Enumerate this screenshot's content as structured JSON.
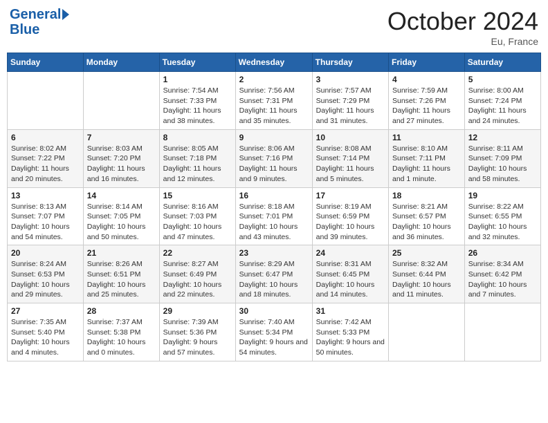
{
  "header": {
    "logo_line1": "General",
    "logo_line2": "Blue",
    "month": "October 2024",
    "location": "Eu, France"
  },
  "weekdays": [
    "Sunday",
    "Monday",
    "Tuesday",
    "Wednesday",
    "Thursday",
    "Friday",
    "Saturday"
  ],
  "weeks": [
    [
      {
        "day": "",
        "info": ""
      },
      {
        "day": "",
        "info": ""
      },
      {
        "day": "1",
        "info": "Sunrise: 7:54 AM\nSunset: 7:33 PM\nDaylight: 11 hours and 38 minutes."
      },
      {
        "day": "2",
        "info": "Sunrise: 7:56 AM\nSunset: 7:31 PM\nDaylight: 11 hours and 35 minutes."
      },
      {
        "day": "3",
        "info": "Sunrise: 7:57 AM\nSunset: 7:29 PM\nDaylight: 11 hours and 31 minutes."
      },
      {
        "day": "4",
        "info": "Sunrise: 7:59 AM\nSunset: 7:26 PM\nDaylight: 11 hours and 27 minutes."
      },
      {
        "day": "5",
        "info": "Sunrise: 8:00 AM\nSunset: 7:24 PM\nDaylight: 11 hours and 24 minutes."
      }
    ],
    [
      {
        "day": "6",
        "info": "Sunrise: 8:02 AM\nSunset: 7:22 PM\nDaylight: 11 hours and 20 minutes."
      },
      {
        "day": "7",
        "info": "Sunrise: 8:03 AM\nSunset: 7:20 PM\nDaylight: 11 hours and 16 minutes."
      },
      {
        "day": "8",
        "info": "Sunrise: 8:05 AM\nSunset: 7:18 PM\nDaylight: 11 hours and 12 minutes."
      },
      {
        "day": "9",
        "info": "Sunrise: 8:06 AM\nSunset: 7:16 PM\nDaylight: 11 hours and 9 minutes."
      },
      {
        "day": "10",
        "info": "Sunrise: 8:08 AM\nSunset: 7:14 PM\nDaylight: 11 hours and 5 minutes."
      },
      {
        "day": "11",
        "info": "Sunrise: 8:10 AM\nSunset: 7:11 PM\nDaylight: 11 hours and 1 minute."
      },
      {
        "day": "12",
        "info": "Sunrise: 8:11 AM\nSunset: 7:09 PM\nDaylight: 10 hours and 58 minutes."
      }
    ],
    [
      {
        "day": "13",
        "info": "Sunrise: 8:13 AM\nSunset: 7:07 PM\nDaylight: 10 hours and 54 minutes."
      },
      {
        "day": "14",
        "info": "Sunrise: 8:14 AM\nSunset: 7:05 PM\nDaylight: 10 hours and 50 minutes."
      },
      {
        "day": "15",
        "info": "Sunrise: 8:16 AM\nSunset: 7:03 PM\nDaylight: 10 hours and 47 minutes."
      },
      {
        "day": "16",
        "info": "Sunrise: 8:18 AM\nSunset: 7:01 PM\nDaylight: 10 hours and 43 minutes."
      },
      {
        "day": "17",
        "info": "Sunrise: 8:19 AM\nSunset: 6:59 PM\nDaylight: 10 hours and 39 minutes."
      },
      {
        "day": "18",
        "info": "Sunrise: 8:21 AM\nSunset: 6:57 PM\nDaylight: 10 hours and 36 minutes."
      },
      {
        "day": "19",
        "info": "Sunrise: 8:22 AM\nSunset: 6:55 PM\nDaylight: 10 hours and 32 minutes."
      }
    ],
    [
      {
        "day": "20",
        "info": "Sunrise: 8:24 AM\nSunset: 6:53 PM\nDaylight: 10 hours and 29 minutes."
      },
      {
        "day": "21",
        "info": "Sunrise: 8:26 AM\nSunset: 6:51 PM\nDaylight: 10 hours and 25 minutes."
      },
      {
        "day": "22",
        "info": "Sunrise: 8:27 AM\nSunset: 6:49 PM\nDaylight: 10 hours and 22 minutes."
      },
      {
        "day": "23",
        "info": "Sunrise: 8:29 AM\nSunset: 6:47 PM\nDaylight: 10 hours and 18 minutes."
      },
      {
        "day": "24",
        "info": "Sunrise: 8:31 AM\nSunset: 6:45 PM\nDaylight: 10 hours and 14 minutes."
      },
      {
        "day": "25",
        "info": "Sunrise: 8:32 AM\nSunset: 6:44 PM\nDaylight: 10 hours and 11 minutes."
      },
      {
        "day": "26",
        "info": "Sunrise: 8:34 AM\nSunset: 6:42 PM\nDaylight: 10 hours and 7 minutes."
      }
    ],
    [
      {
        "day": "27",
        "info": "Sunrise: 7:35 AM\nSunset: 5:40 PM\nDaylight: 10 hours and 4 minutes."
      },
      {
        "day": "28",
        "info": "Sunrise: 7:37 AM\nSunset: 5:38 PM\nDaylight: 10 hours and 0 minutes."
      },
      {
        "day": "29",
        "info": "Sunrise: 7:39 AM\nSunset: 5:36 PM\nDaylight: 9 hours and 57 minutes."
      },
      {
        "day": "30",
        "info": "Sunrise: 7:40 AM\nSunset: 5:34 PM\nDaylight: 9 hours and 54 minutes."
      },
      {
        "day": "31",
        "info": "Sunrise: 7:42 AM\nSunset: 5:33 PM\nDaylight: 9 hours and 50 minutes."
      },
      {
        "day": "",
        "info": ""
      },
      {
        "day": "",
        "info": ""
      }
    ]
  ]
}
